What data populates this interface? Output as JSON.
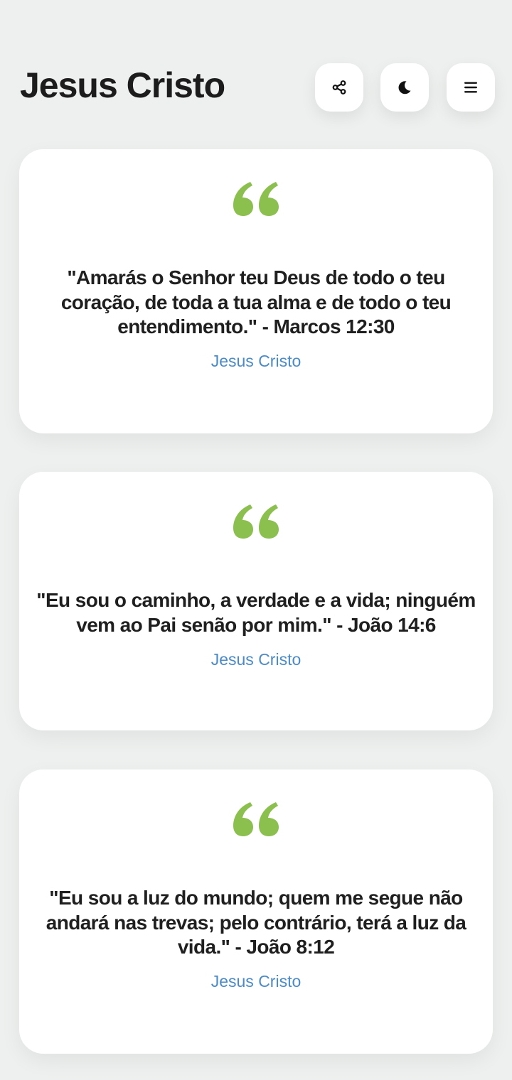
{
  "header": {
    "title": "Jesus Cristo",
    "buttons": [
      {
        "icon": "share-icon"
      },
      {
        "icon": "moon-icon"
      },
      {
        "icon": "menu-icon"
      }
    ]
  },
  "colors": {
    "background": "#eef0ef",
    "card": "#ffffff",
    "quote_mark": "#8bc04e",
    "author": "#4a8ac6",
    "text": "#1f1f1f"
  },
  "quotes": [
    {
      "text": "\"Amarás o Senhor teu Deus de todo o teu coração, de toda a tua alma e de todo o teu entendimento.\" - Marcos 12:30",
      "author": "Jesus Cristo"
    },
    {
      "text": "\"Eu sou o caminho, a verdade e a vida; ninguém vem ao Pai senão por mim.\" - João 14:6",
      "author": "Jesus Cristo"
    },
    {
      "text": "\"Eu sou a luz do mundo; quem me segue não andará nas trevas; pelo contrário, terá a luz da vida.\" - João 8:12",
      "author": "Jesus Cristo"
    }
  ]
}
